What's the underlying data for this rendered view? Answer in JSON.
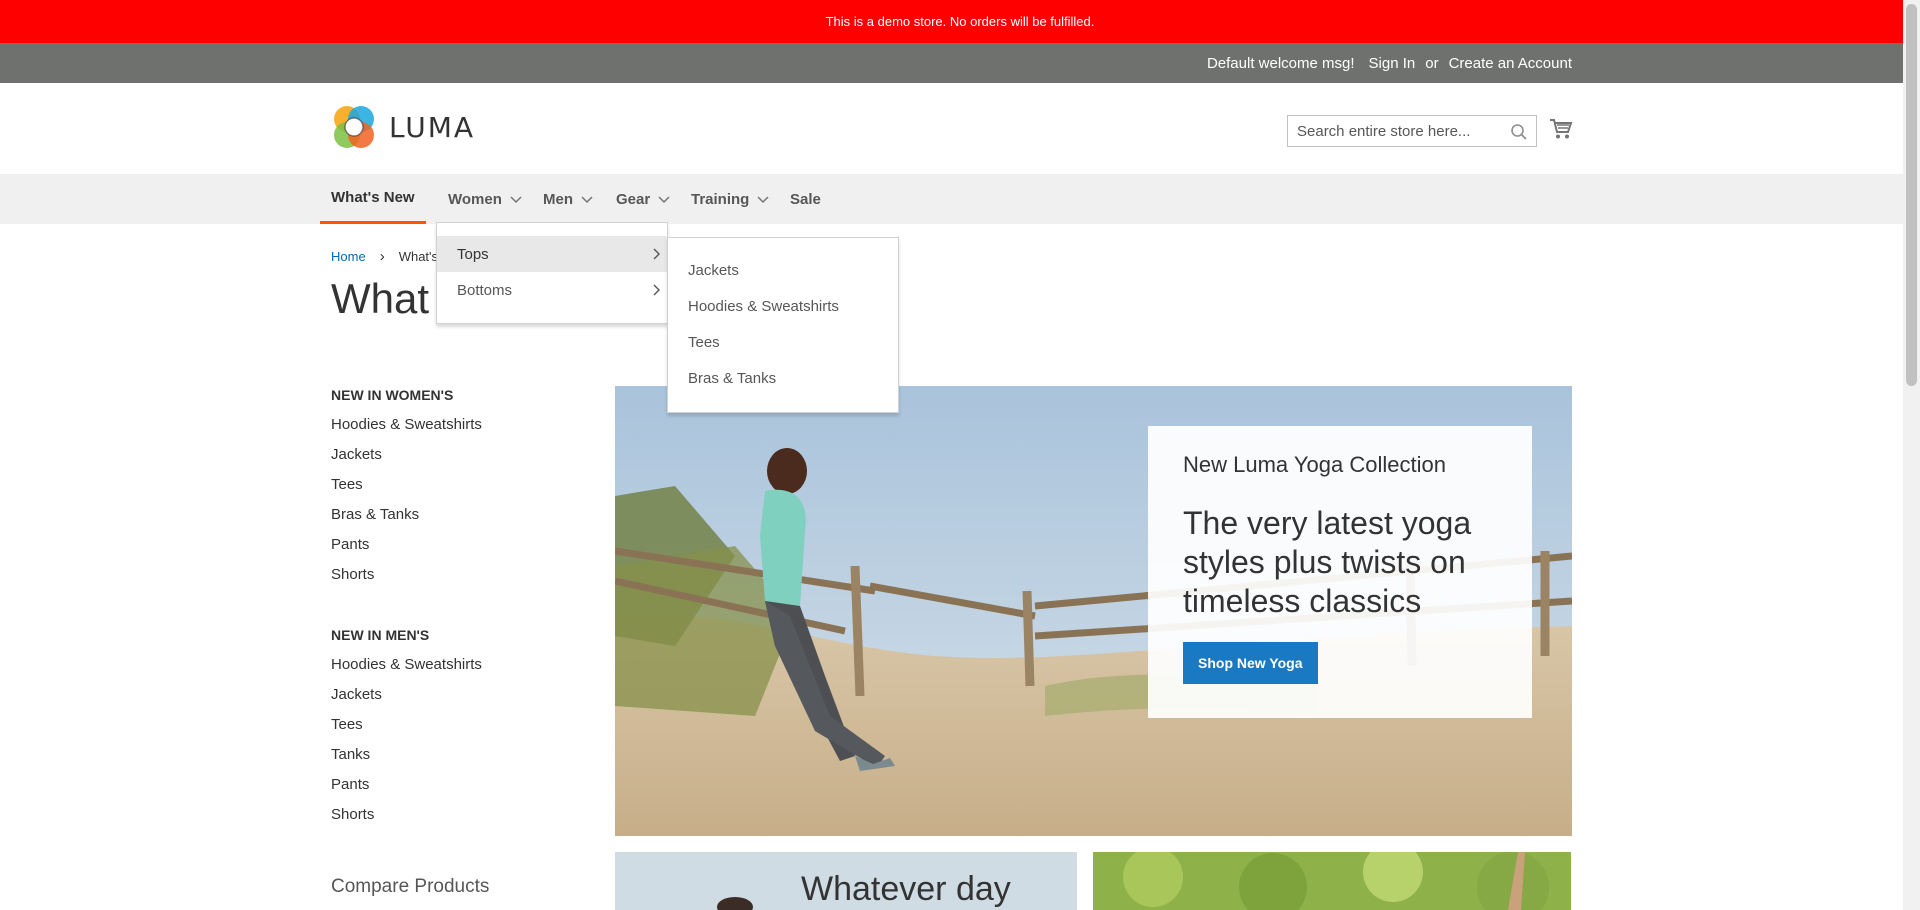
{
  "demo_notice": "This is a demo store. No orders will be fulfilled.",
  "top_links": {
    "welcome": "Default welcome msg!",
    "sign_in": "Sign In",
    "or": "or",
    "create_account": "Create an Account"
  },
  "logo": {
    "text": "LUMA",
    "icon": "luma-logo-icon"
  },
  "search": {
    "placeholder": "Search entire store here...",
    "icon": "search-icon"
  },
  "cart": {
    "icon": "cart-icon"
  },
  "nav": {
    "items": [
      {
        "label": "What's New",
        "active": true
      },
      {
        "label": "Women",
        "has_submenu": true
      },
      {
        "label": "Men",
        "has_submenu": true
      },
      {
        "label": "Gear",
        "has_submenu": true
      },
      {
        "label": "Training",
        "has_submenu": true
      },
      {
        "label": "Sale"
      }
    ]
  },
  "women_menu": {
    "items": [
      {
        "label": "Tops",
        "highlighted": true
      },
      {
        "label": "Bottoms"
      }
    ]
  },
  "tops_menu": {
    "items": [
      {
        "label": "Jackets"
      },
      {
        "label": "Hoodies & Sweatshirts"
      },
      {
        "label": "Tees"
      },
      {
        "label": "Bras & Tanks"
      }
    ]
  },
  "breadcrumb": {
    "home": "Home",
    "current": "What's New"
  },
  "page_title": "What's New",
  "sidebar": {
    "women": {
      "heading": "New in women's",
      "links": [
        "Hoodies & Sweatshirts",
        "Jackets",
        "Tees",
        "Bras & Tanks",
        "Pants",
        "Shorts"
      ]
    },
    "men": {
      "heading": "New in men's",
      "links": [
        "Hoodies & Sweatshirts",
        "Jackets",
        "Tees",
        "Tanks",
        "Pants",
        "Shorts"
      ]
    }
  },
  "compare": "Compare Products",
  "hero": {
    "kicker": "New Luma Yoga Collection",
    "headline": "The very latest yoga styles plus twists on timeless classics",
    "button": "Shop New Yoga"
  },
  "promo": {
    "text": "Whatever day"
  },
  "colors": {
    "demo_bar": "#ff0000",
    "top_bar": "#6e716e",
    "nav_bg": "#f0f0f0",
    "accent_underline": "#ff5501",
    "link_blue": "#006bb4",
    "button_blue": "#1979c3"
  }
}
